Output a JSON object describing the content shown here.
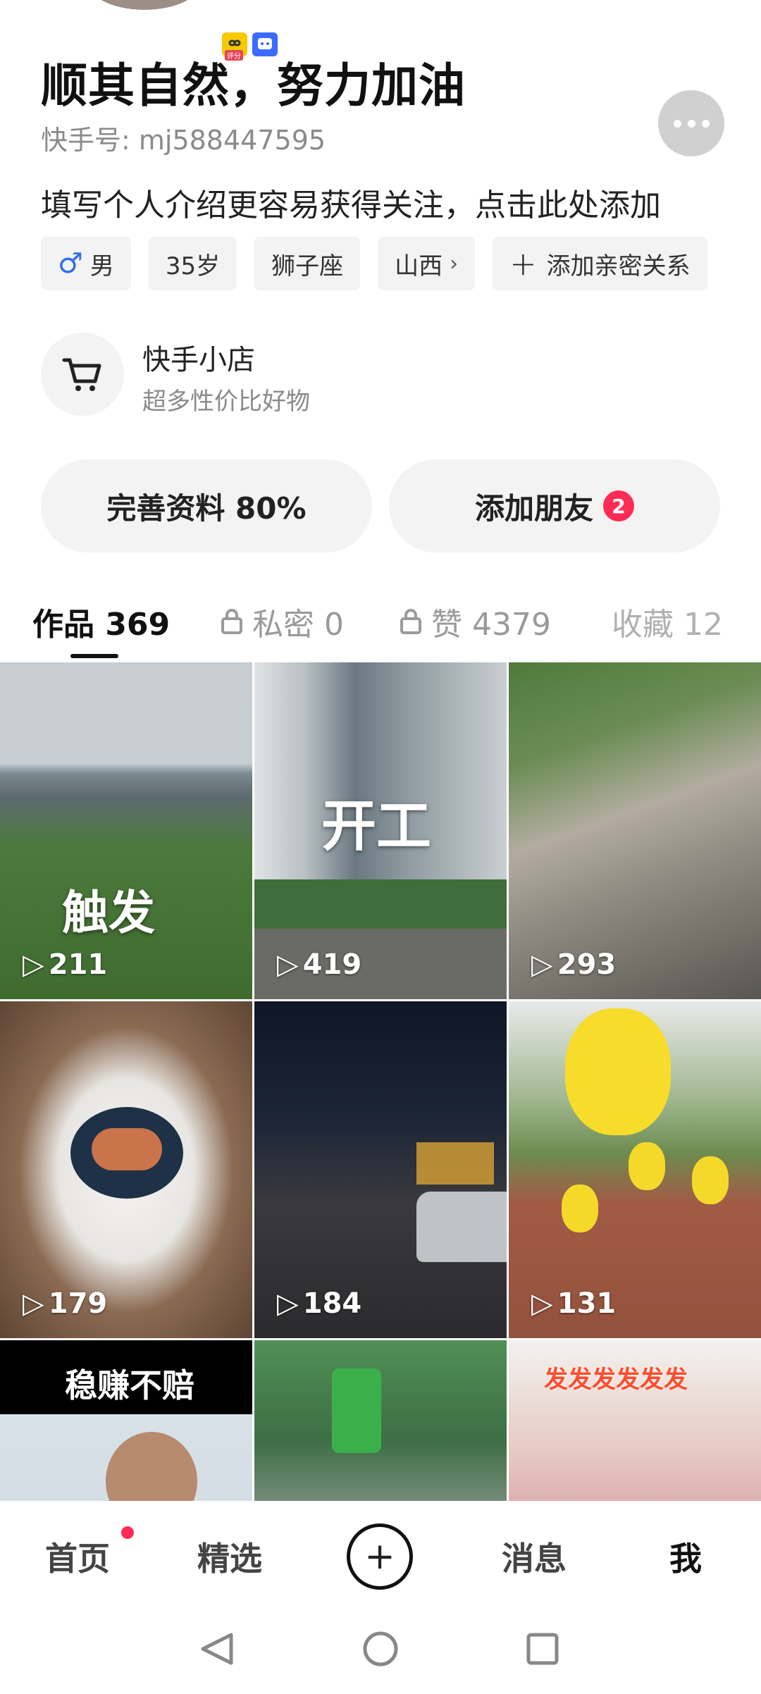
{
  "profile": {
    "name": "顺其自然，努力加油",
    "kwai_id": "快手号: mj588447595",
    "bio": "填写个人介绍更容易获得关注，点击此处添加",
    "badge_small_text": "评分"
  },
  "tags": [
    {
      "label": "男",
      "icon": "male-symbol"
    },
    {
      "label": "35岁"
    },
    {
      "label": "狮子座"
    },
    {
      "label": "山西",
      "icon": "chevron-right"
    },
    {
      "label": "添加亲密关系",
      "icon": "plus"
    }
  ],
  "shop": {
    "title": "快手小店",
    "subtitle": "超多性价比好物",
    "icon": "cart-icon"
  },
  "actions": {
    "complete_profile": "完善资料 80%",
    "add_friends": "添加朋友",
    "add_friends_count": "2"
  },
  "tabs": [
    {
      "label": "作品 369",
      "active": true
    },
    {
      "label": "私密 0",
      "icon": "lock"
    },
    {
      "label": "赞 4379",
      "icon": "lock"
    },
    {
      "label": "收藏 12"
    }
  ],
  "videos": [
    {
      "views": "211",
      "overlay": "触发"
    },
    {
      "views": "419",
      "overlay": "开工"
    },
    {
      "views": "293",
      "overlay": ""
    },
    {
      "views": "179",
      "overlay": ""
    },
    {
      "views": "184",
      "overlay": ""
    },
    {
      "views": "131",
      "overlay": ""
    },
    {
      "views": "",
      "overlay": "稳赚不赔"
    },
    {
      "views": "",
      "overlay": ""
    },
    {
      "views": "",
      "overlay": "发发发发发发"
    }
  ],
  "bottom_nav": {
    "home": "首页",
    "featured": "精选",
    "messages": "消息",
    "me": "我"
  },
  "colors": {
    "accent": "#fe2c55",
    "male": "#2f6ee8"
  }
}
